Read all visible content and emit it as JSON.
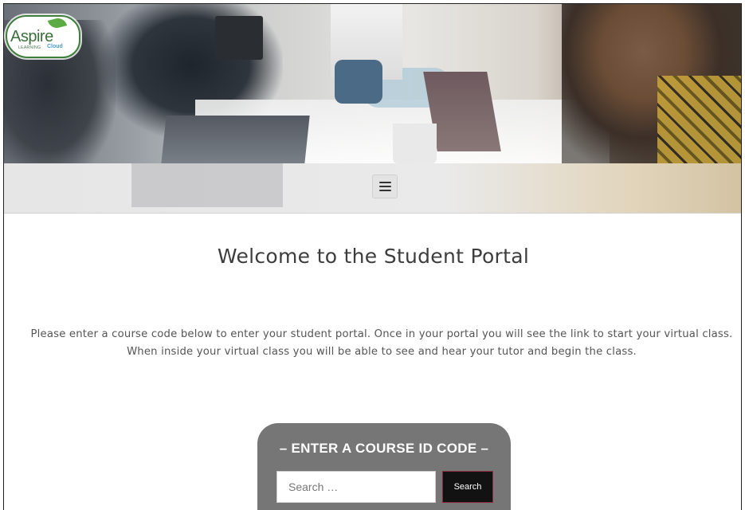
{
  "logo": {
    "main_text": "Aspire",
    "sub_left": "LEARNING",
    "sub_right": "Cloud"
  },
  "nav": {
    "menu_icon": "hamburger-menu-icon"
  },
  "main": {
    "title": "Welcome to the Student Portal",
    "intro": "Please enter a course code below to enter your student portal. Once in your portal you will see the link to start your virtual class. When inside your virtual class you will be able to see and hear your tutor and begin the class."
  },
  "search": {
    "heading": "– ENTER A COURSE ID CODE –",
    "placeholder": "Search …",
    "value": "",
    "button_label": "Search"
  },
  "colors": {
    "search_panel": "#767676",
    "button_bg": "#121212",
    "logo_green": "#3e7f3e"
  }
}
